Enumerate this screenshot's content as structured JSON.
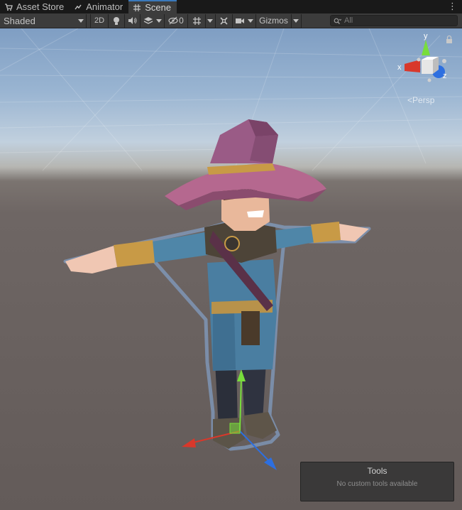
{
  "tabs": [
    {
      "label": "Asset Store",
      "icon": "shopping-cart-icon"
    },
    {
      "label": "Animator",
      "icon": "animator-icon"
    },
    {
      "label": "Scene",
      "icon": "scene-grid-icon",
      "active": true
    }
  ],
  "toolbar": {
    "draw_mode": "Shaded",
    "mode_2d": "2D",
    "hidden_count": "0",
    "gizmos_label": "Gizmos",
    "search_placeholder": "All"
  },
  "viewport": {
    "projection_label": "Persp",
    "axis_labels": {
      "x": "x",
      "y": "y",
      "z": "z"
    }
  },
  "tools_overlay": {
    "title": "Tools",
    "message": "No custom tools available"
  },
  "colors": {
    "tab_active_underline": "#3a79bb",
    "x_axis": "#d8382b",
    "y_axis": "#78dd3c",
    "z_axis": "#2d6fe0"
  }
}
